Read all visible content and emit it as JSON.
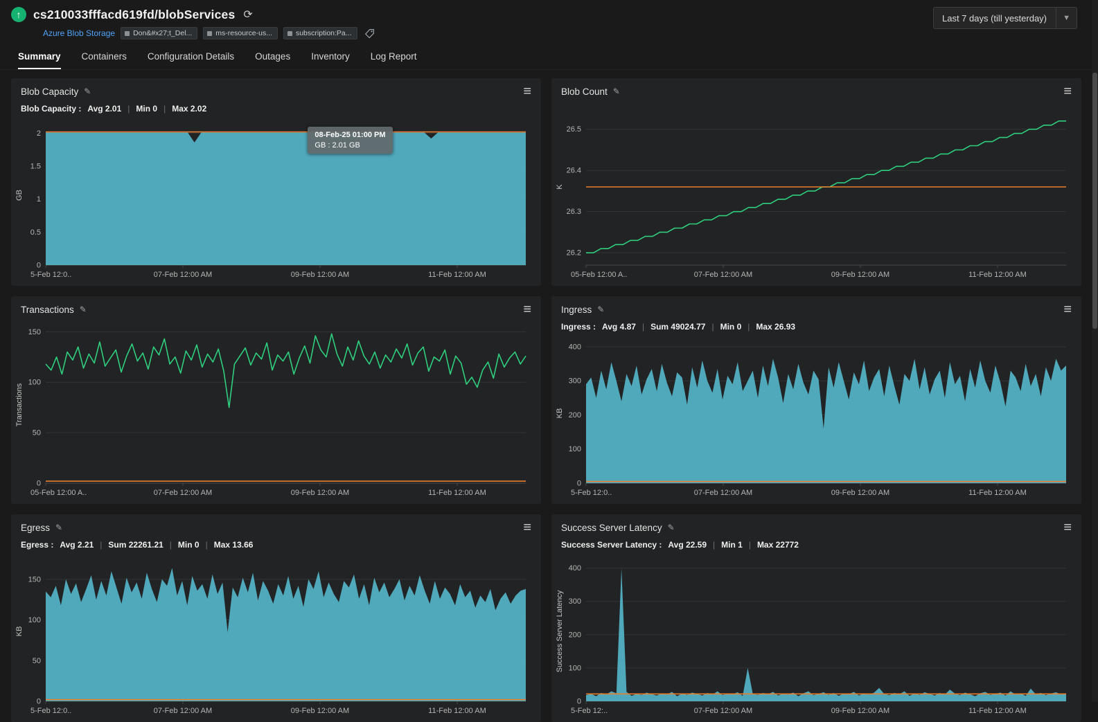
{
  "header": {
    "title": "cs210033fffacd619fd/blobServices",
    "refresh_glyph": "⟳",
    "monitor_type": "Azure Blob Storage",
    "tags": [
      "Don&#x27;t_Del...",
      "ms-resource-us...",
      "subscription:Pa..."
    ],
    "time_range": "Last 7 days (till yesterday)",
    "up_arrow": "↑",
    "caret": "▼"
  },
  "tabs": [
    "Summary",
    "Containers",
    "Configuration Details",
    "Outages",
    "Inventory",
    "Log Report"
  ],
  "active_tab": "Summary",
  "colors": {
    "up_green": "#16b272",
    "area_teal": "#55b4c9",
    "line_green": "#2fcf7f",
    "threshold_orange": "#e87f2f",
    "link_blue": "#4fa3f7"
  },
  "chart_data": [
    {
      "title": "Blob Capacity",
      "type": "area",
      "color": "#55b4c9",
      "ylabel": "GB",
      "ylim": [
        0,
        2.12
      ],
      "yticks": [
        0,
        0.5,
        1,
        1.5,
        2
      ],
      "xticks": [
        "5-Feb 12:0..",
        "07-Feb 12:00 AM",
        "09-Feb 12:00 AM",
        "11-Feb 12:00 AM"
      ],
      "xtick_fracs": [
        0,
        0.2857,
        0.5714,
        0.8571
      ],
      "threshold": 2.02,
      "stats": {
        "label": "Blob Capacity :",
        "items": [
          "Avg 2.01",
          "Min 0",
          "Max 2.02"
        ]
      },
      "tooltip": {
        "line1": "08-Feb-25 01:00 PM",
        "line2": "GB : 2.01 GB"
      },
      "values": [
        2.01,
        2.01,
        2.01,
        2.01,
        2.01,
        2.01,
        2.01,
        2.01,
        2.01,
        2.01,
        2.01,
        2.01,
        2.01,
        2.01,
        2.01,
        2.01,
        2.01,
        2.01,
        2.01,
        2.01,
        2.01,
        2.01,
        1.86,
        2.01,
        2.01,
        2.01,
        2.01,
        2.01,
        2.01,
        2.01,
        2.01,
        2.01,
        2.01,
        2.01,
        2.01,
        2.01,
        2.01,
        2.01,
        2.01,
        2.01,
        2.01,
        2.01,
        2.01,
        2.01,
        2.01,
        2.01,
        2.01,
        2.01,
        2.01,
        2.01,
        2.01,
        2.01,
        2.01,
        2.01,
        2.01,
        2.01,
        2.01,
        1.92,
        2.01,
        2.01,
        2.01,
        2.01,
        2.01,
        2.01,
        2.01,
        2.01,
        2.01,
        2.01,
        2.01,
        2.01,
        2.01,
        2.01
      ]
    },
    {
      "title": "Blob Count",
      "type": "line",
      "color": "#2fcf7f",
      "ylabel": "K",
      "ylim": [
        26.17,
        26.55
      ],
      "yticks": [
        26.2,
        26.3,
        26.4,
        26.5
      ],
      "xticks": [
        "05-Feb 12:00 A..",
        "07-Feb 12:00 AM",
        "09-Feb 12:00 AM",
        "11-Feb 12:00 AM"
      ],
      "xtick_fracs": [
        0,
        0.2857,
        0.5714,
        0.8571
      ],
      "threshold": 26.36,
      "stats": null,
      "values": [
        26.2,
        26.2,
        26.21,
        26.21,
        26.22,
        26.22,
        26.23,
        26.23,
        26.24,
        26.24,
        26.25,
        26.25,
        26.26,
        26.26,
        26.27,
        26.27,
        26.28,
        26.28,
        26.29,
        26.29,
        26.3,
        26.3,
        26.31,
        26.31,
        26.32,
        26.32,
        26.33,
        26.33,
        26.34,
        26.34,
        26.35,
        26.35,
        26.36,
        26.36,
        26.37,
        26.37,
        26.38,
        26.38,
        26.39,
        26.39,
        26.4,
        26.4,
        26.41,
        26.41,
        26.42,
        26.42,
        26.43,
        26.43,
        26.44,
        26.44,
        26.45,
        26.45,
        26.46,
        26.46,
        26.47,
        26.47,
        26.48,
        26.48,
        26.49,
        26.49,
        26.5,
        26.5,
        26.51,
        26.51,
        26.52,
        26.52
      ]
    },
    {
      "title": "Transactions",
      "type": "line",
      "color": "#2fcf7f",
      "ylabel": "Transactions",
      "ylim": [
        0,
        155
      ],
      "yticks": [
        0,
        50,
        100,
        150
      ],
      "xticks": [
        "05-Feb 12:00 A..",
        "07-Feb 12:00 AM",
        "09-Feb 12:00 AM",
        "11-Feb 12:00 AM"
      ],
      "xtick_fracs": [
        0,
        0.2857,
        0.5714,
        0.8571
      ],
      "threshold": 2,
      "stats": null,
      "values": [
        118,
        112,
        125,
        108,
        130,
        122,
        135,
        114,
        128,
        119,
        140,
        116,
        124,
        132,
        110,
        126,
        138,
        121,
        129,
        113,
        135,
        127,
        143,
        118,
        125,
        109,
        131,
        122,
        137,
        115,
        128,
        120,
        133,
        111,
        75,
        118,
        126,
        134,
        117,
        129,
        123,
        139,
        112,
        127,
        121,
        130,
        108,
        124,
        136,
        119,
        146,
        132,
        125,
        148,
        128,
        116,
        135,
        122,
        141,
        126,
        118,
        130,
        114,
        127,
        120,
        133,
        124,
        138,
        117,
        129,
        135,
        111,
        125,
        121,
        132,
        108,
        126,
        119,
        98,
        105,
        95,
        112,
        120,
        104,
        128,
        115,
        124,
        130,
        118,
        126
      ]
    },
    {
      "title": "Ingress",
      "type": "area",
      "color": "#55b4c9",
      "ylabel": "KB",
      "ylim": [
        0,
        410
      ],
      "yticks": [
        0,
        100,
        200,
        300,
        400
      ],
      "xticks": [
        "5-Feb 12:0..",
        "07-Feb 12:00 AM",
        "09-Feb 12:00 AM",
        "11-Feb 12:00 AM"
      ],
      "xtick_fracs": [
        0,
        0.2857,
        0.5714,
        0.8571
      ],
      "threshold": 5,
      "stats": {
        "label": "Ingress :",
        "items": [
          "Avg 4.87",
          "Sum 49024.77",
          "Min 0",
          "Max 26.93"
        ]
      },
      "values": [
        290,
        310,
        250,
        330,
        275,
        355,
        300,
        240,
        320,
        285,
        345,
        260,
        305,
        335,
        270,
        350,
        295,
        255,
        325,
        310,
        230,
        340,
        280,
        360,
        300,
        265,
        335,
        245,
        315,
        290,
        355,
        270,
        300,
        330,
        250,
        345,
        285,
        365,
        310,
        235,
        320,
        275,
        350,
        295,
        260,
        330,
        305,
        160,
        340,
        280,
        355,
        300,
        245,
        325,
        290,
        360,
        270,
        310,
        335,
        255,
        345,
        285,
        230,
        320,
        300,
        365,
        275,
        340,
        260,
        305,
        330,
        250,
        355,
        290,
        315,
        240,
        335,
        280,
        360,
        300,
        265,
        345,
        295,
        225,
        330,
        310,
        270,
        350,
        285,
        320,
        255,
        340,
        300,
        365,
        330,
        345
      ]
    },
    {
      "title": "Egress",
      "type": "area",
      "color": "#55b4c9",
      "ylabel": "KB",
      "ylim": [
        0,
        172
      ],
      "yticks": [
        0,
        50,
        100,
        150
      ],
      "xticks": [
        "5-Feb 12:0..",
        "07-Feb 12:00 AM",
        "09-Feb 12:00 AM",
        "11-Feb 12:00 AM"
      ],
      "xtick_fracs": [
        0,
        0.2857,
        0.5714,
        0.8571
      ],
      "threshold": 2,
      "stats": {
        "label": "Egress :",
        "items": [
          "Avg 2.21",
          "Sum 22261.21",
          "Min 0",
          "Max 13.66"
        ]
      },
      "values": [
        135,
        128,
        142,
        118,
        150,
        132,
        145,
        122,
        138,
        155,
        125,
        148,
        130,
        160,
        140,
        120,
        152,
        134,
        146,
        126,
        158,
        138,
        122,
        150,
        142,
        164,
        130,
        148,
        118,
        154,
        136,
        144,
        126,
        156,
        132,
        146,
        85,
        140,
        128,
        152,
        134,
        158,
        124,
        148,
        136,
        120,
        144,
        130,
        154,
        126,
        142,
        116,
        150,
        138,
        160,
        128,
        146,
        132,
        122,
        148,
        140,
        156,
        126,
        144,
        118,
        152,
        134,
        146,
        128,
        138,
        150,
        124,
        142,
        130,
        155,
        136,
        120,
        148,
        126,
        140,
        132,
        118,
        144,
        128,
        136,
        115,
        130,
        122,
        138,
        112,
        126,
        134,
        120,
        130,
        136,
        138
      ]
    },
    {
      "title": "Success Server Latency",
      "type": "area",
      "color": "#55b4c9",
      "ylabel": "Success Server Latency",
      "ylim": [
        0,
        420
      ],
      "yticks": [
        0,
        100,
        200,
        300,
        400
      ],
      "xticks": [
        "5-Feb 12:..",
        "07-Feb 12:00 AM",
        "09-Feb 12:00 AM",
        "11-Feb 12:00 AM"
      ],
      "xtick_fracs": [
        0,
        0.2857,
        0.5714,
        0.8571
      ],
      "threshold": 22,
      "stats": {
        "label": "Success Server Latency :",
        "items": [
          "Avg 22.59",
          "Min 1",
          "Max 22772"
        ]
      },
      "values": [
        18,
        22,
        15,
        25,
        20,
        30,
        24,
        400,
        28,
        16,
        22,
        19,
        26,
        21,
        17,
        24,
        20,
        28,
        15,
        23,
        19,
        26,
        22,
        17,
        25,
        20,
        30,
        18,
        24,
        21,
        27,
        16,
        100,
        22,
        19,
        25,
        21,
        28,
        17,
        23,
        20,
        26,
        15,
        24,
        30,
        18,
        22,
        27,
        19,
        25,
        16,
        23,
        21,
        28,
        17,
        24,
        20,
        26,
        40,
        22,
        18,
        25,
        21,
        30,
        16,
        24,
        19,
        27,
        22,
        17,
        25,
        20,
        35,
        23,
        18,
        26,
        21,
        15,
        24,
        28,
        19,
        22,
        26,
        17,
        30,
        20,
        24,
        16,
        38,
        21,
        25,
        18,
        23,
        27,
        20,
        24
      ]
    }
  ]
}
